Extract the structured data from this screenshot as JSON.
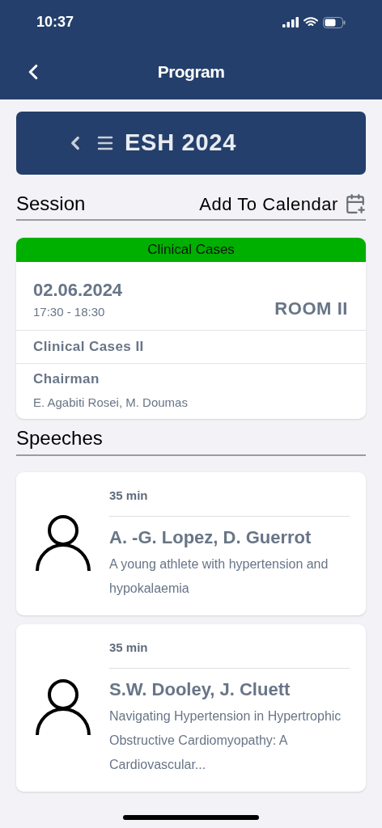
{
  "status_bar": {
    "time": "10:37"
  },
  "nav_bar": {
    "title": "Program"
  },
  "event_header": {
    "title": "ESH 2024"
  },
  "session_heading": {
    "title": "Session",
    "action": "Add To Calendar"
  },
  "session": {
    "category": "Clinical Cases",
    "color": "#00b000",
    "date": "02.06.2024",
    "time": "17:30 - 18:30",
    "room": "ROOM II",
    "name": "Clinical Cases II",
    "chair_label": "Chairman",
    "chairs": "E. Agabiti Rosei, M. Doumas"
  },
  "speeches_heading": {
    "title": "Speeches"
  },
  "speeches": [
    {
      "duration": "35 min",
      "speakers": "A. -G. Lopez, D. Guerrot",
      "title": "A young athlete with hypertension and hypokalaemia"
    },
    {
      "duration": "35 min",
      "speakers": "S.W. Dooley, J. Cluett",
      "title": "Navigating Hypertension in Hypertrophic Obstructive Cardiomyopathy: A Cardiovascular..."
    }
  ]
}
